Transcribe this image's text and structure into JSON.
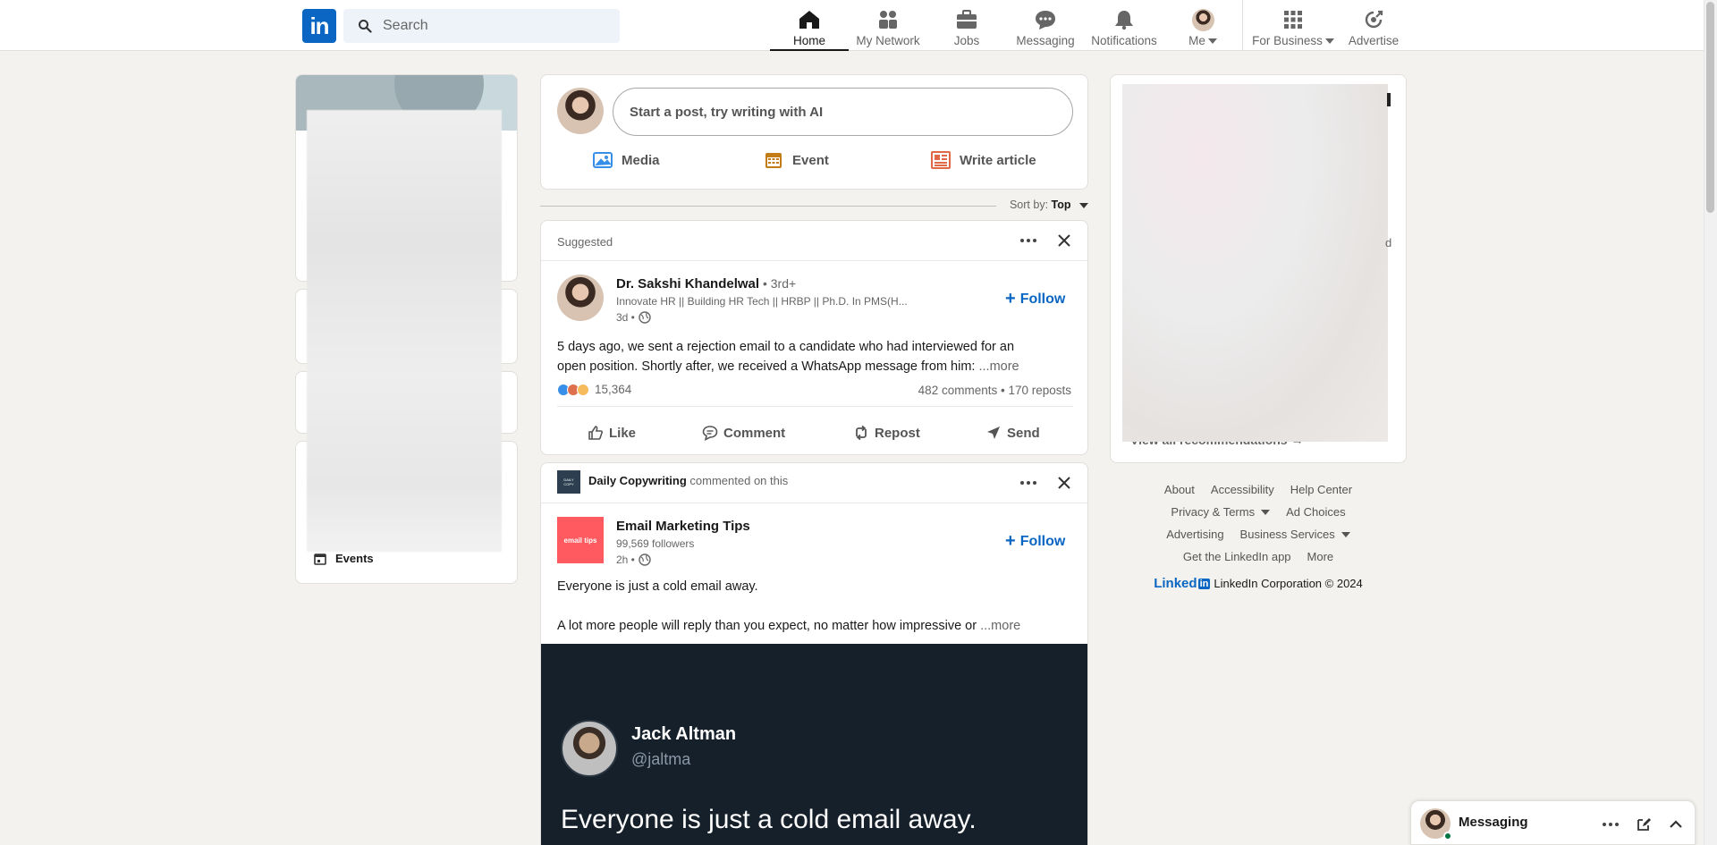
{
  "nav": {
    "logo": "in",
    "search_placeholder": "Search",
    "items": [
      {
        "label": "Home",
        "icon": "home-icon"
      },
      {
        "label": "My Network",
        "icon": "network-icon"
      },
      {
        "label": "Jobs",
        "icon": "briefcase-icon"
      },
      {
        "label": "Messaging",
        "icon": "chat-icon"
      },
      {
        "label": "Notifications",
        "icon": "bell-icon"
      },
      {
        "label": "Me",
        "icon": "avatar"
      },
      {
        "label": "For Business",
        "icon": "grid-icon"
      },
      {
        "label": "Advertise",
        "icon": "advertise-icon"
      }
    ]
  },
  "left": {
    "events_label": "Events"
  },
  "share_box": {
    "prompt": "Start a post, try writing with AI",
    "actions": [
      {
        "label": "Media",
        "icon": "image-icon",
        "color": "#378fe9"
      },
      {
        "label": "Event",
        "icon": "calendar-icon",
        "color": "#c37d16"
      },
      {
        "label": "Write article",
        "icon": "article-icon",
        "color": "#e06847"
      }
    ]
  },
  "sort": {
    "label": "Sort by:",
    "value": "Top"
  },
  "post1": {
    "header": "Suggested",
    "author": "Dr. Sakshi Khandelwal",
    "degree": " • 3rd+",
    "headline": "Innovate HR || Building HR Tech || HRBP || Ph.D. In PMS(H...",
    "time": "3d •",
    "text_line1": "5 days ago, we sent a rejection email to a candidate who had interviewed for an",
    "text_line2": "open position. Shortly after, we received a WhatsApp message from him:",
    "more": "...more",
    "reactions_count": "15,364",
    "comments_reposts": "482 comments • 170 reposts",
    "follow_label": "Follow",
    "actions": [
      "Like",
      "Comment",
      "Repost",
      "Send"
    ]
  },
  "post2": {
    "commenter": "Daily Copywriting",
    "commented_text": "commented on this",
    "logo_text": "email tips",
    "company": "Email Marketing Tips",
    "followers": "99,569 followers",
    "time": "2h •",
    "follow_label": "Follow",
    "text_line1": "Everyone is just a cold email away.",
    "text_line2": "A lot more people will reply than you expect, no matter how impressive or",
    "more": "...more",
    "tweet": {
      "name": "Jack Altman",
      "handle": "@jaltma",
      "text": "Everyone is just a cold email away."
    }
  },
  "right": {
    "view_all": "View all recommendations →",
    "side_letter": "d"
  },
  "footer": {
    "row1": [
      "About",
      "Accessibility",
      "Help Center"
    ],
    "row2": [
      "Privacy & Terms",
      "Ad Choices"
    ],
    "row3": [
      "Advertising",
      "Business Services"
    ],
    "row4": [
      "Get the LinkedIn app",
      "More"
    ],
    "brand": "Linked",
    "brand_in": "in",
    "copyright": "LinkedIn Corporation © 2024"
  },
  "messaging": {
    "label": "Messaging"
  },
  "colors": {
    "brand": "#0a66c2",
    "background": "#f4f2ee",
    "tweet_bg": "#15202b"
  }
}
